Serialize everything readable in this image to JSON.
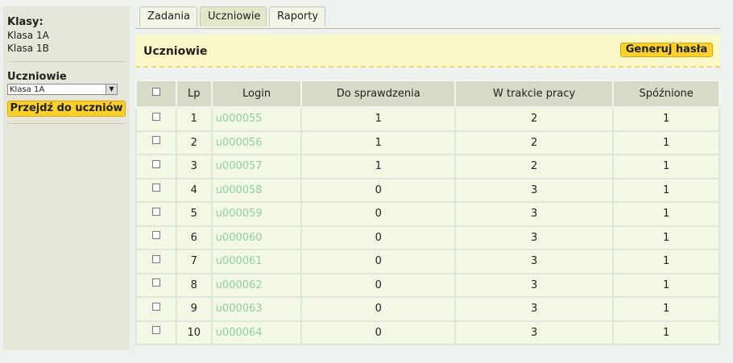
{
  "sidebar": {
    "classes_title": "Klasy:",
    "classes": [
      "Klasa 1A",
      "Klasa 1B"
    ],
    "students_title": "Uczniowie",
    "selected_class": "Klasa 1A",
    "go_button": "Przejdź do uczniów"
  },
  "tabs": [
    "Zadania",
    "Uczniowie",
    "Raporty"
  ],
  "active_tab": "Uczniowie",
  "header": {
    "title": "Uczniowie",
    "generate_button": "Generuj hasła"
  },
  "table": {
    "columns": [
      "Lp",
      "Login",
      "Do sprawdzenia",
      "W trakcie pracy",
      "Spóźnione"
    ],
    "rows": [
      {
        "lp": "1",
        "login": "u000055",
        "to_check": "1",
        "in_progress": "2",
        "late": "1"
      },
      {
        "lp": "2",
        "login": "u000056",
        "to_check": "1",
        "in_progress": "2",
        "late": "1"
      },
      {
        "lp": "3",
        "login": "u000057",
        "to_check": "1",
        "in_progress": "2",
        "late": "1"
      },
      {
        "lp": "4",
        "login": "u000058",
        "to_check": "0",
        "in_progress": "3",
        "late": "1"
      },
      {
        "lp": "5",
        "login": "u000059",
        "to_check": "0",
        "in_progress": "3",
        "late": "1"
      },
      {
        "lp": "6",
        "login": "u000060",
        "to_check": "0",
        "in_progress": "3",
        "late": "1"
      },
      {
        "lp": "7",
        "login": "u000061",
        "to_check": "0",
        "in_progress": "3",
        "late": "1"
      },
      {
        "lp": "8",
        "login": "u000062",
        "to_check": "0",
        "in_progress": "3",
        "late": "1"
      },
      {
        "lp": "9",
        "login": "u000063",
        "to_check": "0",
        "in_progress": "3",
        "late": "1"
      },
      {
        "lp": "10",
        "login": "u000064",
        "to_check": "0",
        "in_progress": "3",
        "late": "1"
      }
    ]
  },
  "colors": {
    "accent_button": "#fcd02b",
    "login_link": "#8fd0a4",
    "header_bg": "#faf7c8"
  }
}
